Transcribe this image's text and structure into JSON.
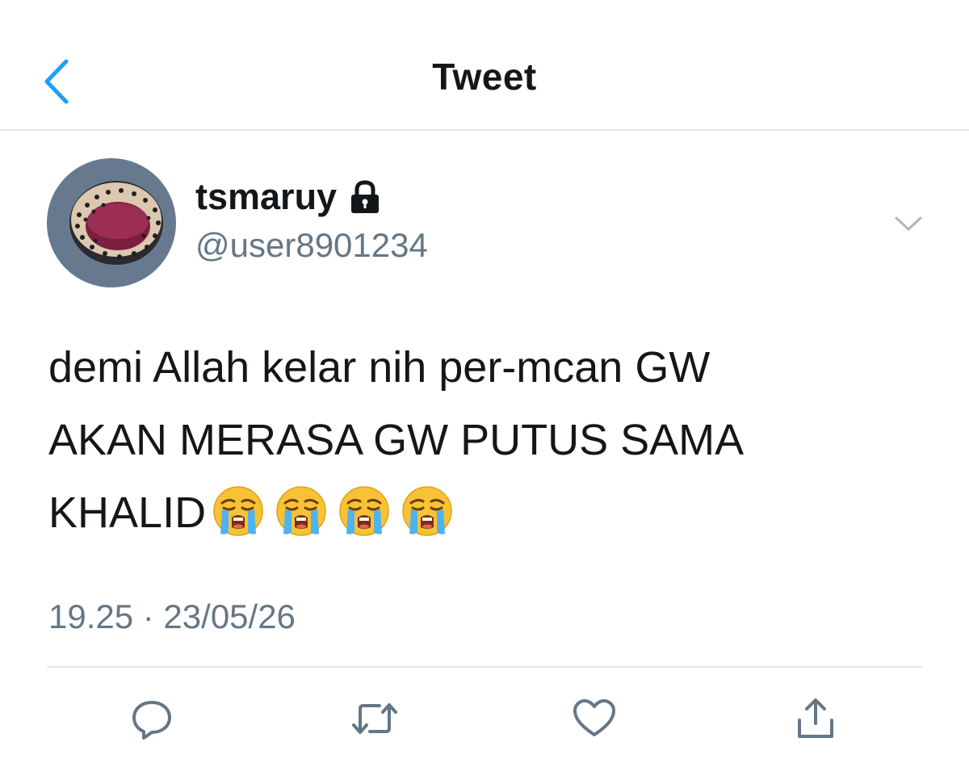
{
  "header": {
    "title": "Tweet",
    "back_icon": "chevron-left-icon"
  },
  "tweet": {
    "author": {
      "display_name": "tsmaruy",
      "handle": "@user8901234",
      "protected_icon": "lock-icon"
    },
    "menu_icon": "chevron-down-icon",
    "text": "demi Allah kelar nih per-mcan GW\nAKAN MERASA GW PUTUS SAMA\nKHALID",
    "emojis": [
      "loudly-crying-face",
      "loudly-crying-face",
      "loudly-crying-face",
      "loudly-crying-face"
    ],
    "timestamp": "19.25 · 23/05/26"
  },
  "actions": [
    {
      "name": "reply",
      "icon": "reply-icon"
    },
    {
      "name": "retweet",
      "icon": "retweet-icon"
    },
    {
      "name": "like",
      "icon": "heart-icon"
    },
    {
      "name": "share",
      "icon": "share-icon"
    }
  ],
  "colors": {
    "accent": "#1da1f2",
    "text_primary": "#14171a",
    "text_secondary": "#657786",
    "divider": "#e1e8ed",
    "icon_gray": "#657786"
  }
}
